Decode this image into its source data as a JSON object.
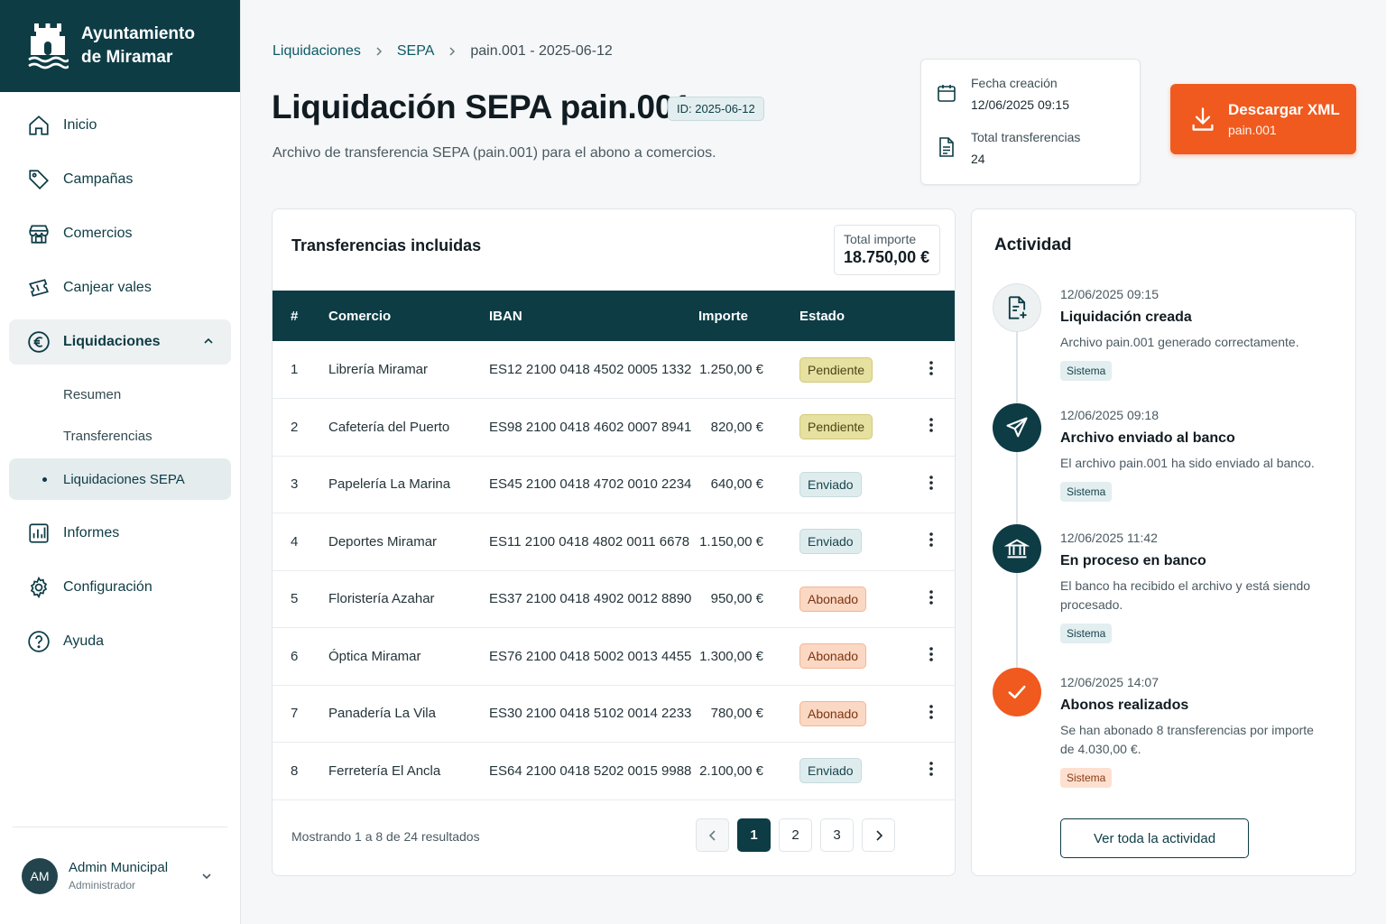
{
  "brand": {
    "line1": "Ayuntamiento",
    "line2": "de Miramar"
  },
  "sidebar": {
    "items": [
      {
        "label": "Inicio",
        "icon": "home-icon"
      },
      {
        "label": "Campañas",
        "icon": "tag-icon"
      },
      {
        "label": "Comercios",
        "icon": "store-icon"
      },
      {
        "label": "Canjear vales",
        "icon": "ticket-icon"
      },
      {
        "label": "Liquidaciones",
        "icon": "euro-icon"
      },
      {
        "label": "Informes",
        "icon": "chart-icon"
      },
      {
        "label": "Configuración",
        "icon": "gear-icon"
      },
      {
        "label": "Ayuda",
        "icon": "help-icon"
      }
    ],
    "subitems": [
      "Resumen",
      "Transferencias",
      "Liquidaciones SEPA"
    ],
    "user": {
      "initials": "AM",
      "name": "Admin Municipal",
      "role": "Administrador"
    }
  },
  "breadcrumb": [
    "Liquidaciones",
    "SEPA",
    "pain.001 - 2025-06-12"
  ],
  "header": {
    "title": "Liquidación SEPA pain.001",
    "id_badge": "ID: 2025-06-12",
    "subtitle": "Archivo de transferencia SEPA (pain.001) para el abono a comercios."
  },
  "meta": {
    "created_label": "Fecha creación",
    "created_value": "12/06/2025 09:15",
    "count_label": "Total transferencias",
    "count_value": "24"
  },
  "download": {
    "label": "Descargar XML",
    "sub": "pain.001"
  },
  "transfers": {
    "title": "Transferencias incluidas",
    "total_label": "Total importe",
    "total_value": "18.750,00 €",
    "columns": [
      "#",
      "Comercio",
      "IBAN",
      "Importe",
      "Estado"
    ],
    "rows": [
      {
        "n": "1",
        "comercio": "Librería Miramar",
        "iban": "ES12 2100 0418 4502 0005 1332",
        "importe": "1.250,00 €",
        "estado": "Pendiente",
        "kind": "pend"
      },
      {
        "n": "2",
        "comercio": "Cafetería del Puerto",
        "iban": "ES98 2100 0418 4602 0007 8941",
        "importe": "820,00 €",
        "estado": "Pendiente",
        "kind": "pend"
      },
      {
        "n": "3",
        "comercio": "Papelería La Marina",
        "iban": "ES45 2100 0418 4702 0010 2234",
        "importe": "640,00 €",
        "estado": "Enviado",
        "kind": "env"
      },
      {
        "n": "4",
        "comercio": "Deportes Miramar",
        "iban": "ES11 2100 0418 4802 0011 6678",
        "importe": "1.150,00 €",
        "estado": "Enviado",
        "kind": "env"
      },
      {
        "n": "5",
        "comercio": "Floristería Azahar",
        "iban": "ES37 2100 0418 4902 0012 8890",
        "importe": "950,00 €",
        "estado": "Abonado",
        "kind": "abo"
      },
      {
        "n": "6",
        "comercio": "Óptica Miramar",
        "iban": "ES76 2100 0418 5002 0013 4455",
        "importe": "1.300,00 €",
        "estado": "Abonado",
        "kind": "abo"
      },
      {
        "n": "7",
        "comercio": "Panadería La Vila",
        "iban": "ES30 2100 0418 5102 0014 2233",
        "importe": "780,00 €",
        "estado": "Abonado",
        "kind": "abo"
      },
      {
        "n": "8",
        "comercio": "Ferretería El Ancla",
        "iban": "ES64 2100 0418 5202 0015 9988",
        "importe": "2.100,00 €",
        "estado": "Enviado",
        "kind": "env"
      }
    ],
    "footer": "Mostrando 1 a 8 de 24 resultados",
    "pages": [
      "1",
      "2",
      "3"
    ]
  },
  "colors": {
    "primary": "#0d3c45",
    "accent": "#f05a1e",
    "pending": "#e6e0a1",
    "sent": "#dfecee",
    "paid": "#fbd8c4"
  },
  "activity": {
    "title": "Actividad",
    "events": [
      {
        "time": "12/06/2025 09:15",
        "title": "Liquidación creada",
        "desc": "Archivo pain.001 generado correctamente.",
        "tag": "Sistema",
        "icon": "file-plus-icon"
      },
      {
        "time": "12/06/2025 09:18",
        "title": "Archivo enviado al banco",
        "desc": "El archivo pain.001 ha sido enviado al banco.",
        "tag": "Sistema",
        "icon": "send-icon"
      },
      {
        "time": "12/06/2025 11:42",
        "title": "En proceso en banco",
        "desc": "El banco ha recibido el archivo y está siendo procesado.",
        "tag": "Sistema",
        "icon": "bank-icon"
      },
      {
        "time": "12/06/2025 14:07",
        "title": "Abonos realizados",
        "desc": "Se han abonado 8 transferencias por importe de 4.030,00 €.",
        "tag": "Sistema",
        "icon": "check-icon"
      }
    ],
    "button": "Ver toda la actividad"
  }
}
